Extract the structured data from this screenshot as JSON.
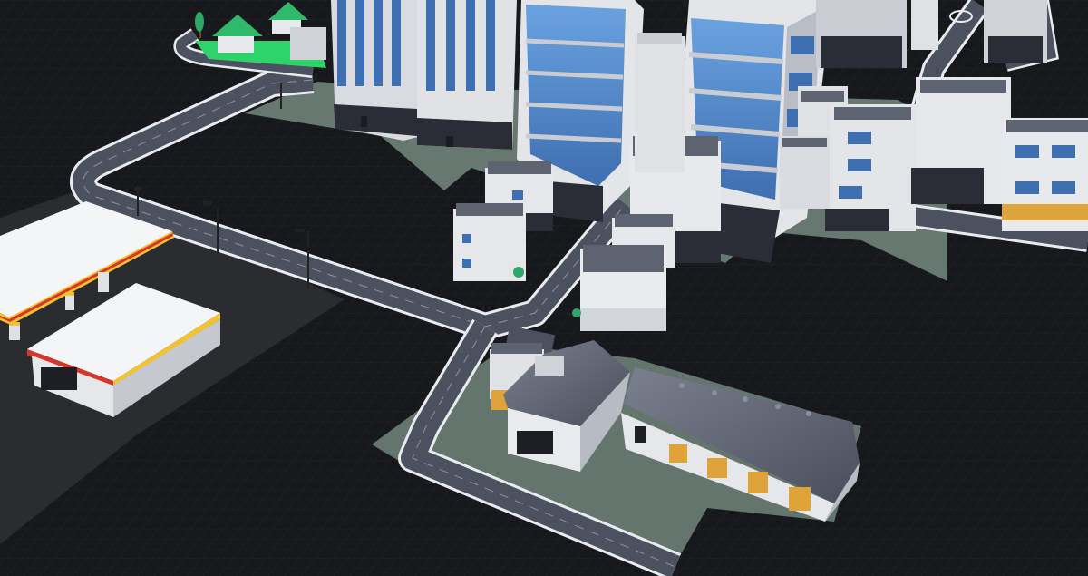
{
  "scene": {
    "kind": "3d-city-builder-viewport",
    "palette": {
      "void": "#17181c",
      "grid_line": "#22252b",
      "road": "#4c5160",
      "road_edge": "#e9ebef",
      "lane_mark": "#9aa0ad",
      "plaza": "#6b7f78",
      "lot": "#3a3b3e",
      "glass": "#4f86c9",
      "tower_wall": "#d9dbe0",
      "tower_dark": "#2a2d35",
      "roof_slate": "#5e6372",
      "garage_door": "#e0a33a",
      "house_roof": "#2fb96b",
      "lawn": "#2ed36b",
      "canopy_stripe_red": "#d8362c",
      "canopy_stripe_yellow": "#f2c230",
      "tree": "#2fa866"
    },
    "objects": [
      {
        "name": "gas-station",
        "type": "fuel-canopy"
      },
      {
        "name": "convenience-store",
        "type": "shop"
      },
      {
        "name": "glass-tower",
        "type": "skyscraper"
      },
      {
        "name": "office-tower",
        "type": "skyscraper"
      },
      {
        "name": "apartment-block",
        "type": "midrise"
      },
      {
        "name": "warehouse",
        "type": "industrial"
      },
      {
        "name": "workshop",
        "type": "industrial"
      },
      {
        "name": "suburban-house",
        "type": "residential"
      },
      {
        "name": "street-lamp",
        "type": "prop"
      }
    ]
  }
}
